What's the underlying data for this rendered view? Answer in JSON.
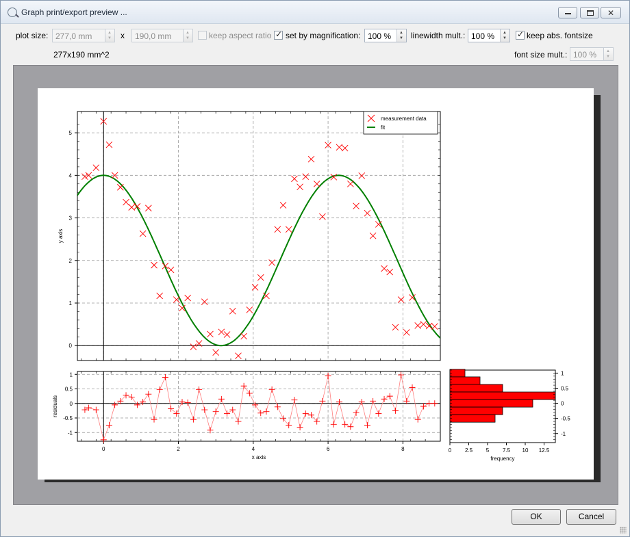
{
  "window": {
    "title": "Graph print/export preview ..."
  },
  "controls": {
    "plot_size_label": "plot size:",
    "width_value": "277,0 mm",
    "x_label": "x",
    "height_value": "190,0 mm",
    "keep_aspect_label": "keep aspect ratio",
    "keep_aspect_checked": false,
    "set_by_mag_label": "set by magnification:",
    "set_by_mag_checked": true,
    "magnification_value": "100 %",
    "linewidth_label": "linewidth mult.:",
    "linewidth_value": "100 %",
    "keep_fontsize_label": "keep abs. fontsize",
    "keep_fontsize_checked": true,
    "area_text": "277x190 mm^2",
    "fontsize_label": "font size mult.:",
    "fontsize_value": "100 %"
  },
  "buttons": {
    "ok": "OK",
    "cancel": "Cancel"
  },
  "icons": {
    "window": "preview-icon",
    "minimize": "minimize-icon",
    "maximize": "maximize-icon",
    "close": "close-icon",
    "spin_up": "arrow-up-icon",
    "spin_down": "arrow-down-icon",
    "check": "checkmark-icon"
  },
  "colors": {
    "data": "#ff0000",
    "fit": "#008000",
    "histogram": "#ff0000",
    "grid": "#999999"
  },
  "chart_data": [
    {
      "type": "scatter",
      "ylabel": "y axis",
      "xlim": [
        -0.7,
        9.0
      ],
      "ylim": [
        -0.35,
        5.5
      ],
      "yticks": [
        "0",
        "1",
        "2",
        "3",
        "4",
        "5"
      ],
      "grid": true,
      "legend_position": "top-right",
      "legend": [
        "measurement data",
        "fit"
      ],
      "series": [
        {
          "name": "measurement data",
          "marker": "x",
          "x": [
            -0.5,
            -0.4,
            -0.2,
            0.0,
            0.15,
            0.3,
            0.45,
            0.6,
            0.75,
            0.9,
            1.05,
            1.2,
            1.35,
            1.5,
            1.65,
            1.8,
            1.95,
            2.1,
            2.25,
            2.4,
            2.55,
            2.7,
            2.85,
            3.0,
            3.15,
            3.3,
            3.45,
            3.6,
            3.75,
            3.9,
            4.05,
            4.2,
            4.35,
            4.5,
            4.65,
            4.8,
            4.95,
            5.1,
            5.25,
            5.4,
            5.55,
            5.7,
            5.85,
            6.0,
            6.15,
            6.3,
            6.45,
            6.6,
            6.75,
            6.9,
            7.05,
            7.2,
            7.35,
            7.5,
            7.65,
            7.8,
            7.95,
            8.1,
            8.25,
            8.4,
            8.55,
            8.7,
            8.85
          ],
          "y": [
            3.97,
            4.0,
            4.18,
            5.27,
            4.72,
            4.0,
            3.72,
            3.37,
            3.25,
            3.27,
            2.63,
            3.23,
            1.89,
            1.17,
            1.87,
            1.78,
            1.08,
            0.88,
            1.12,
            -0.03,
            0.05,
            1.03,
            0.27,
            -0.16,
            0.32,
            0.26,
            0.81,
            -0.24,
            0.22,
            0.84,
            1.37,
            1.6,
            1.17,
            1.95,
            2.73,
            3.3,
            2.73,
            3.92,
            3.73,
            3.97,
            4.38,
            3.8,
            3.03,
            4.71,
            3.96,
            4.66,
            4.64,
            3.8,
            3.28,
            3.99,
            3.11,
            2.58,
            2.85,
            1.81,
            1.73,
            0.43,
            1.08,
            0.31,
            1.13,
            0.47,
            0.5,
            0.46,
            0.45
          ]
        },
        {
          "name": "fit",
          "type": "line",
          "model": "2 + 2*cos(x)",
          "x_range": [
            -0.7,
            9.0
          ]
        }
      ]
    },
    {
      "type": "line",
      "xlabel": "x axis",
      "ylabel": "residuals",
      "xlim": [
        -0.7,
        9.0
      ],
      "ylim": [
        -1.3,
        1.1
      ],
      "xticks": [
        "0",
        "2",
        "4",
        "6",
        "8"
      ],
      "yticks": [
        "1",
        "0.5",
        "0",
        "-0.5",
        "-1"
      ],
      "grid": true,
      "series": [
        {
          "name": "residuals",
          "marker": "+",
          "x": [
            -0.5,
            -0.4,
            -0.2,
            0.0,
            0.15,
            0.3,
            0.45,
            0.6,
            0.75,
            0.9,
            1.05,
            1.2,
            1.35,
            1.5,
            1.65,
            1.8,
            1.95,
            2.1,
            2.25,
            2.4,
            2.55,
            2.7,
            2.85,
            3.0,
            3.15,
            3.3,
            3.45,
            3.6,
            3.75,
            3.9,
            4.05,
            4.2,
            4.35,
            4.5,
            4.65,
            4.8,
            4.95,
            5.1,
            5.25,
            5.4,
            5.55,
            5.7,
            5.85,
            6.0,
            6.15,
            6.3,
            6.45,
            6.6,
            6.75,
            6.9,
            7.05,
            7.2,
            7.35,
            7.5,
            7.65,
            7.8,
            7.95,
            8.1,
            8.25,
            8.4,
            8.55,
            8.7,
            8.85
          ],
          "y": [
            -0.22,
            -0.15,
            -0.22,
            -1.25,
            -0.75,
            -0.05,
            0.08,
            0.28,
            0.22,
            -0.05,
            0.05,
            0.32,
            -0.55,
            0.48,
            0.9,
            -0.18,
            -0.35,
            0.05,
            0.03,
            -0.55,
            0.48,
            -0.22,
            -0.92,
            -0.28,
            0.15,
            -0.35,
            -0.22,
            -0.62,
            0.6,
            0.35,
            -0.05,
            -0.33,
            -0.28,
            0.48,
            -0.12,
            -0.52,
            -0.75,
            0.12,
            -0.82,
            -0.35,
            -0.4,
            -0.62,
            0.08,
            0.95,
            -0.72,
            0.05,
            -0.72,
            -0.8,
            -0.32,
            0.05,
            -0.75,
            0.08,
            -0.35,
            0.15,
            0.25,
            -0.25,
            0.98,
            0.08,
            0.55,
            -0.55,
            -0.1,
            0.0,
            0.0
          ]
        }
      ]
    },
    {
      "type": "bar",
      "orientation": "horizontal",
      "xlabel": "frequency",
      "xlim": [
        0,
        14
      ],
      "xticks": [
        "0",
        "2.5",
        "5",
        "7.5",
        "10",
        "12.5"
      ],
      "yticks": [
        "1",
        "0.5",
        "0",
        "-0.5",
        "-1"
      ],
      "bins": [
        1.0,
        0.75,
        0.5,
        0.25,
        0.0,
        -0.25,
        -0.5,
        -0.75
      ],
      "values": [
        2,
        4,
        7,
        14,
        11,
        7,
        6,
        0
      ]
    }
  ]
}
